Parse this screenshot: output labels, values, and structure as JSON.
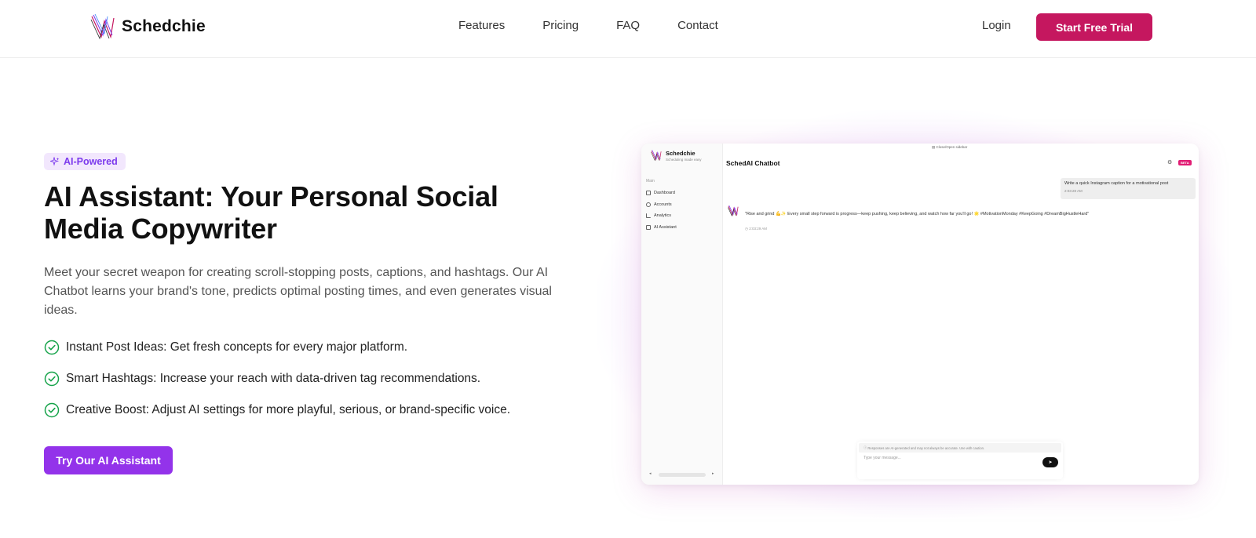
{
  "brand": {
    "name": "Schedchie"
  },
  "nav": {
    "items": [
      "Features",
      "Pricing",
      "FAQ",
      "Contact"
    ]
  },
  "header": {
    "login_label": "Login",
    "trial_label": "Start Free Trial"
  },
  "hero": {
    "badge": "AI-Powered",
    "title": "AI Assistant: Your Personal Social Media Copywriter",
    "description": "Meet your secret weapon for creating scroll-stopping posts, captions, and hashtags. Our AI Chatbot learns your brand's tone, predicts optimal posting times, and even generates visual ideas.",
    "features": [
      "Instant Post Ideas: Get fresh concepts for every major platform.",
      "Smart Hashtags: Increase your reach with data-driven tag recommendations.",
      "Creative Boost: Adjust AI settings for more playful, serious, or brand-specific voice."
    ],
    "cta_label": "Try Our AI Assistant"
  },
  "preview": {
    "brand_name": "Schedchie",
    "brand_sub": "Scheduling made easy",
    "top_bar": "Close/Open sidebar",
    "sidebar_section": "Main",
    "sidebar_items": [
      "Dashboard",
      "Accounts",
      "Analytics",
      "AI Assistant"
    ],
    "chat_title": "SchedAI Chatbot",
    "beta_label": "BETA",
    "user_message": "Write a quick Instagram caption for a motivational post",
    "user_time": "2:03:28 AM",
    "bot_message": "\"Rise and grind 💪✨ Every small step forward is progress—keep pushing, keep believing, and watch how far you'll go! 🌟 #MotivationMonday #KeepGoing #DreamBigHustleHard\"",
    "bot_time": "2:03:29 AM",
    "disclaimer": "Responses are AI-generated and may not always be accurate. Use with caution.",
    "input_placeholder": "Type your message..."
  },
  "colors": {
    "primary_brand": "#c5175f",
    "accent_purple": "#9333ea",
    "check_green": "#16a34a"
  }
}
